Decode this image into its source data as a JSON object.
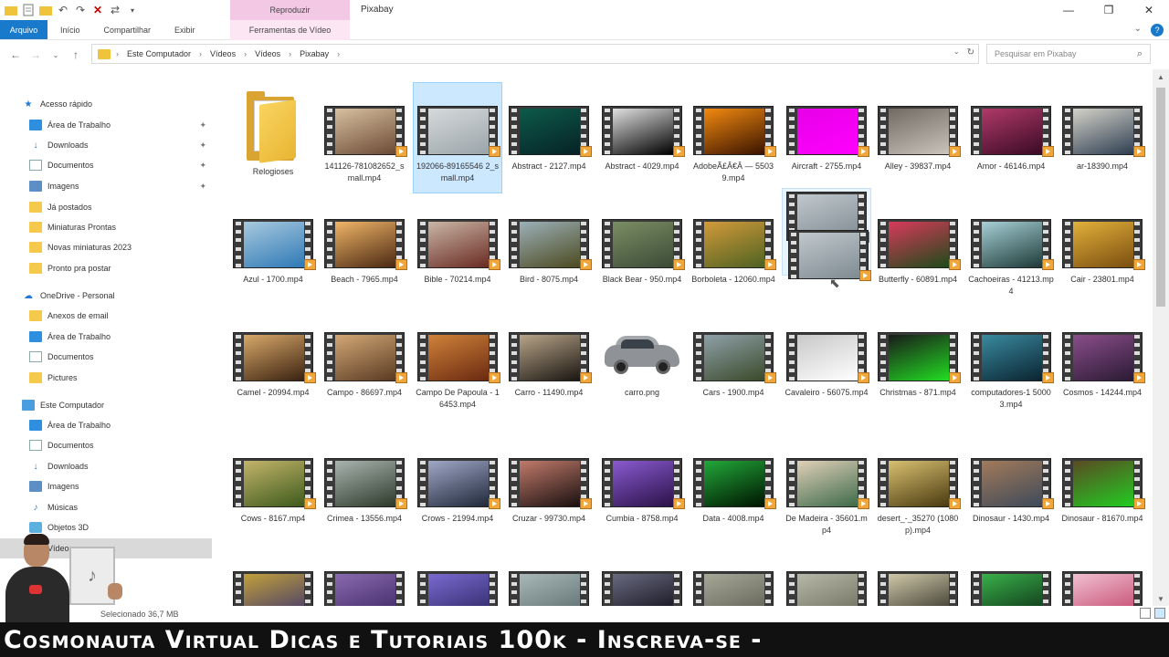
{
  "window": {
    "context_tab_header": "Reproduzir",
    "title": "Pixabay",
    "colors": {
      "accent": "#1979ca",
      "context": "#f2c8e4",
      "selection": "#cce8ff"
    }
  },
  "ribbon": {
    "tabs": [
      "Arquivo",
      "Início",
      "Compartilhar",
      "Exibir"
    ],
    "context_tab": "Ferramentas de Vídeo"
  },
  "address": {
    "crumbs": [
      "Este Computador",
      "Vídeos",
      "Vídeos",
      "Pixabay"
    ],
    "search_placeholder": "Pesquisar em Pixabay"
  },
  "sidebar": {
    "items": [
      {
        "label": "Acesso rápido",
        "icon": "star-icon",
        "indent": 0,
        "pinned": false
      },
      {
        "label": "Área de Trabalho",
        "icon": "desktop-icon",
        "indent": 1,
        "pinned": true
      },
      {
        "label": "Downloads",
        "icon": "download-icon",
        "indent": 1,
        "pinned": true
      },
      {
        "label": "Documentos",
        "icon": "document-icon",
        "indent": 1,
        "pinned": true
      },
      {
        "label": "Imagens",
        "icon": "pictures-icon",
        "indent": 1,
        "pinned": true
      },
      {
        "label": "Já postados",
        "icon": "folder-icon",
        "indent": 1,
        "pinned": false
      },
      {
        "label": "Miniaturas Prontas",
        "icon": "folder-icon",
        "indent": 1,
        "pinned": false
      },
      {
        "label": "Novas miniaturas 2023",
        "icon": "folder-icon",
        "indent": 1,
        "pinned": false
      },
      {
        "label": "Pronto pra postar",
        "icon": "folder-icon",
        "indent": 1,
        "pinned": false
      },
      {
        "label": "OneDrive - Personal",
        "icon": "cloud-icon",
        "indent": 0,
        "pinned": false
      },
      {
        "label": "Anexos de email",
        "icon": "folder-icon",
        "indent": 1,
        "pinned": false
      },
      {
        "label": "Área de Trabalho",
        "icon": "desktop-icon",
        "indent": 1,
        "pinned": false
      },
      {
        "label": "Documentos",
        "icon": "document-icon",
        "indent": 1,
        "pinned": false
      },
      {
        "label": "Pictures",
        "icon": "folder-icon",
        "indent": 1,
        "pinned": false
      },
      {
        "label": "Este Computador",
        "icon": "computer-icon",
        "indent": 0,
        "pinned": false
      },
      {
        "label": "Área de Trabalho",
        "icon": "desktop-icon",
        "indent": 1,
        "pinned": false
      },
      {
        "label": "Documentos",
        "icon": "document-icon",
        "indent": 1,
        "pinned": false
      },
      {
        "label": "Downloads",
        "icon": "download-icon",
        "indent": 1,
        "pinned": false
      },
      {
        "label": "Imagens",
        "icon": "pictures-icon",
        "indent": 1,
        "pinned": false
      },
      {
        "label": "Músicas",
        "icon": "music-icon",
        "indent": 1,
        "pinned": false
      },
      {
        "label": "Objetos 3D",
        "icon": "3d-objects-icon",
        "indent": 1,
        "pinned": false
      },
      {
        "label": "Vídeos",
        "icon": "video-icon",
        "indent": 1,
        "pinned": false,
        "selected": true
      }
    ]
  },
  "status": {
    "selected_text": "Selecionado 36,7 MB"
  },
  "banner": {
    "text": "Cosmonauta Virtual Dicas e Tutoriais 100k - Inscreva-se -"
  },
  "files": [
    {
      "name": "Relogioses",
      "kind": "folder"
    },
    {
      "name": "141126-781082652_small.mp4",
      "kind": "video",
      "c1": "#6b4a34",
      "c2": "#d8c0a0"
    },
    {
      "name": "192066-89165546 2_small.mp4",
      "kind": "video",
      "c1": "#9aa4a8",
      "c2": "#d6dadc",
      "selected": true
    },
    {
      "name": "Abstract - 2127.mp4",
      "kind": "video",
      "c1": "#062226",
      "c2": "#0d5a4a"
    },
    {
      "name": "Abstract - 4029.mp4",
      "kind": "video",
      "c1": "#000000",
      "c2": "#e0e0e0"
    },
    {
      "name": "AdobeÃ£Â€Â — 55039.mp4",
      "kind": "video",
      "c1": "#3a1300",
      "c2": "#f28a10"
    },
    {
      "name": "Aircraft - 2755.mp4",
      "kind": "video",
      "c1": "#ff00ff",
      "c2": "#e600e6"
    },
    {
      "name": "Alley - 39837.mp4",
      "kind": "video",
      "c1": "#c9c3bb",
      "c2": "#706a63"
    },
    {
      "name": "Amor - 46146.mp4",
      "kind": "video",
      "c1": "#3a0a24",
      "c2": "#b03a6a"
    },
    {
      "name": "ar-18390.mp4",
      "kind": "video",
      "c1": "#2e3e52",
      "c2": "#d4d2c8"
    },
    {
      "name": "Azul - 1700.mp4",
      "kind": "video",
      "c1": "#2f79b6",
      "c2": "#a7c9de"
    },
    {
      "name": "Beach - 7965.mp4",
      "kind": "video",
      "c1": "#4a2812",
      "c2": "#f0b568"
    },
    {
      "name": "Bible - 70214.mp4",
      "kind": "video",
      "c1": "#6a2a22",
      "c2": "#c9b6a6"
    },
    {
      "name": "Bird - 8075.mp4",
      "kind": "video",
      "c1": "#4c4a20",
      "c2": "#9cb0b8"
    },
    {
      "name": "Black Bear - 950.mp4",
      "kind": "video",
      "c1": "#3c4a36",
      "c2": "#7a8e64"
    },
    {
      "name": "Borboleta - 12060.mp4",
      "kind": "video",
      "c1": "#4e6222",
      "c2": "#d29a3a"
    },
    {
      "name": "",
      "kind": "video",
      "c1": "#7f8a92",
      "c2": "#c0c8cc",
      "drag": true
    },
    {
      "name": "Butterfly - 60891.mp4",
      "kind": "video",
      "c1": "#1e4a1a",
      "c2": "#d83a5a"
    },
    {
      "name": "Cachoeiras - 41213.mp4",
      "kind": "video",
      "c1": "#1e3a38",
      "c2": "#a6d0d6"
    },
    {
      "name": "Cair - 23801.mp4",
      "kind": "video",
      "c1": "#7a4e10",
      "c2": "#e2b03a"
    },
    {
      "name": "Camel - 20994.mp4",
      "kind": "video",
      "c1": "#3a2210",
      "c2": "#d9a86a"
    },
    {
      "name": "Campo - 86697.mp4",
      "kind": "video",
      "c1": "#5a3a22",
      "c2": "#d2a876"
    },
    {
      "name": "Campo De Papoula - 16453.mp4",
      "kind": "video",
      "c1": "#6a2a10",
      "c2": "#d0823a"
    },
    {
      "name": "Carro - 11490.mp4",
      "kind": "video",
      "c1": "#1a1612",
      "c2": "#b8a488"
    },
    {
      "name": "carro.png",
      "kind": "car"
    },
    {
      "name": "Cars - 1900.mp4",
      "kind": "video",
      "c1": "#3a4a2a",
      "c2": "#8fa0a8"
    },
    {
      "name": "Cavaleiro - 56075.mp4",
      "kind": "video",
      "c1": "#ffffff",
      "c2": "#c8c8c8"
    },
    {
      "name": "Christmas - 871.mp4",
      "kind": "video",
      "c1": "#22dd22",
      "c2": "#1a1a1a"
    },
    {
      "name": "computadores-1 50003.mp4",
      "kind": "video",
      "c1": "#0a2430",
      "c2": "#3a8aa0"
    },
    {
      "name": "Cosmos - 14244.mp4",
      "kind": "video",
      "c1": "#2a1a34",
      "c2": "#8a4e8a"
    },
    {
      "name": "Cows - 8167.mp4",
      "kind": "video",
      "c1": "#3e5a1c",
      "c2": "#c2b46a"
    },
    {
      "name": "Crimea - 13556.mp4",
      "kind": "video",
      "c1": "#2c3a2a",
      "c2": "#aab4b0"
    },
    {
      "name": "Crows - 21994.mp4",
      "kind": "video",
      "c1": "#20283a",
      "c2": "#a0a8c8"
    },
    {
      "name": "Cruzar - 99730.mp4",
      "kind": "video",
      "c1": "#1a1010",
      "c2": "#c07a6a"
    },
    {
      "name": "Cumbia - 8758.mp4",
      "kind": "video",
      "c1": "#2a1248",
      "c2": "#8a5ad0"
    },
    {
      "name": "Data - 4008.mp4",
      "kind": "video",
      "c1": "#001400",
      "c2": "#22a83a"
    },
    {
      "name": "De Madeira - 35601.mp4",
      "kind": "video",
      "c1": "#3e6a4a",
      "c2": "#e0d0b8"
    },
    {
      "name": "desert_-_35270 (1080p).mp4",
      "kind": "video",
      "c1": "#4a3a10",
      "c2": "#d8c070"
    },
    {
      "name": "Dinosaur - 1430.mp4",
      "kind": "video",
      "c1": "#3e4a5a",
      "c2": "#a27a5a"
    },
    {
      "name": "Dinosaur - 81670.mp4",
      "kind": "video",
      "c1": "#22cc22",
      "c2": "#5a4a22"
    },
    {
      "name": "",
      "kind": "video",
      "c1": "#3a3270",
      "c2": "#c2a03a"
    },
    {
      "name": "",
      "kind": "video",
      "c1": "#3a2460",
      "c2": "#8a6ab0"
    },
    {
      "name": "",
      "kind": "video",
      "c1": "#2a2460",
      "c2": "#7a6ad0"
    },
    {
      "name": "",
      "kind": "video",
      "c1": "#5a6a6a",
      "c2": "#a8b8b8"
    },
    {
      "name": "",
      "kind": "video",
      "c1": "#0a0a14",
      "c2": "#6a6a80"
    },
    {
      "name": "",
      "kind": "video",
      "c1": "#5a5a50",
      "c2": "#a8a898"
    },
    {
      "name": "",
      "kind": "video",
      "c1": "#6a6a5a",
      "c2": "#b8b8a8"
    },
    {
      "name": "",
      "kind": "video",
      "c1": "#2a2a22",
      "c2": "#d0c8a8"
    },
    {
      "name": "",
      "kind": "video",
      "c1": "#0a2a14",
      "c2": "#3ab04a"
    },
    {
      "name": "",
      "kind": "video",
      "c1": "#c2406a",
      "c2": "#f0c0d0"
    }
  ]
}
